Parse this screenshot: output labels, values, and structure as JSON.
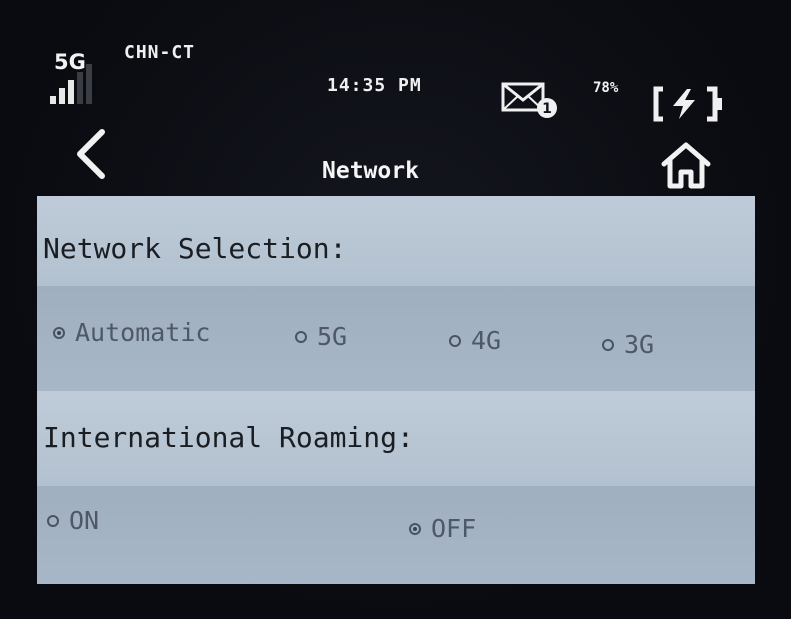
{
  "status_bar": {
    "network_type": "5G",
    "carrier": "CHN-CT",
    "time": "14:35 PM",
    "unread_messages": "1",
    "battery_percent": "78%",
    "signal_level": 0.6,
    "icons": [
      "signal-icon",
      "mail-icon",
      "battery-charging-icon"
    ]
  },
  "title_bar": {
    "title": "Network",
    "icons": [
      "back-icon",
      "home-icon"
    ]
  },
  "network_selection": {
    "label": "Network Selection:",
    "options": [
      "Automatic",
      "5G",
      "4G",
      "3G"
    ],
    "selected": "Automatic"
  },
  "international_roaming": {
    "label": "International Roaming:",
    "options": [
      "ON",
      "OFF"
    ],
    "selected": "OFF"
  },
  "colors": {
    "screen_bg": "#0d0f16",
    "panel_bg": "#aebdcc",
    "text_dark": "#1a1d22",
    "text_option": "#4e5866"
  }
}
